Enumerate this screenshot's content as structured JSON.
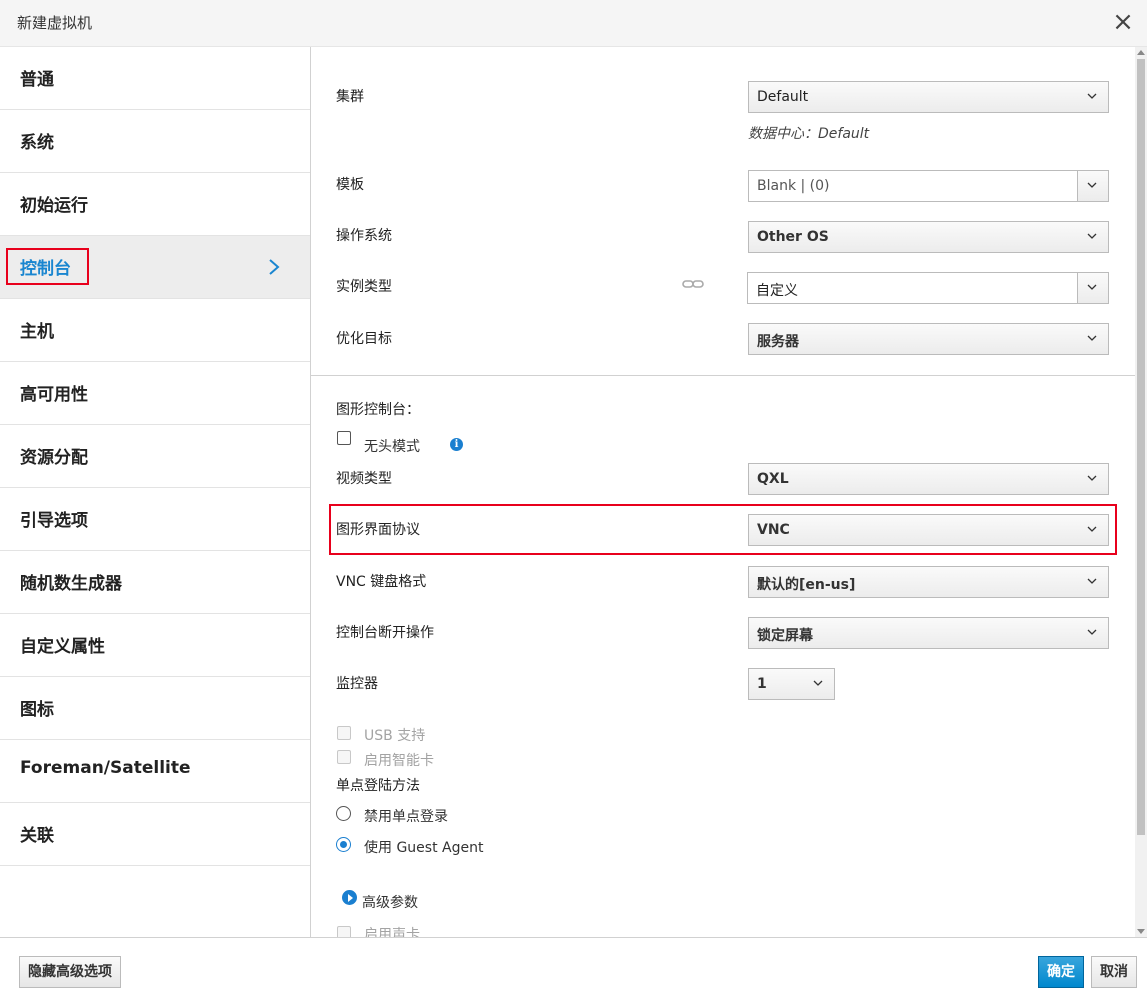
{
  "dialog": {
    "title": "新建虚拟机"
  },
  "sidebar": {
    "items": [
      {
        "label": "普通"
      },
      {
        "label": "系统"
      },
      {
        "label": "初始运行"
      },
      {
        "label": "控制台"
      },
      {
        "label": "主机"
      },
      {
        "label": "高可用性"
      },
      {
        "label": "资源分配"
      },
      {
        "label": "引导选项"
      },
      {
        "label": "随机数生成器"
      },
      {
        "label": "自定义属性"
      },
      {
        "label": "图标"
      },
      {
        "label": "Foreman/Satellite"
      },
      {
        "label": "关联"
      }
    ],
    "active_index": 3
  },
  "general": {
    "cluster": {
      "label": "集群",
      "value": "Default",
      "hint": "数据中心：Default"
    },
    "template": {
      "label": "模板",
      "value": "Blank |  (0)"
    },
    "os": {
      "label": "操作系统",
      "value": "Other OS"
    },
    "instance_type": {
      "label": "实例类型",
      "value": "自定义"
    },
    "optimized_for": {
      "label": "优化目标",
      "value": "服务器"
    }
  },
  "console": {
    "section_title": "图形控制台：",
    "headless": {
      "label": "无头模式",
      "checked": false
    },
    "video_type": {
      "label": "视频类型",
      "value": "QXL"
    },
    "graphics_protocol": {
      "label": "图形界面协议",
      "value": "VNC"
    },
    "vnc_keymap": {
      "label": "VNC 键盘格式",
      "value": "默认的[en-us]"
    },
    "disconnect_action": {
      "label": "控制台断开操作",
      "value": "锁定屏幕"
    },
    "monitors": {
      "label": "监控器",
      "value": "1"
    },
    "usb_support": {
      "label": "USB 支持",
      "checked": false,
      "disabled": true
    },
    "smartcard": {
      "label": "启用智能卡",
      "checked": false,
      "disabled": true
    },
    "sso_method": {
      "label": "单点登陆方法",
      "options": [
        {
          "label": "禁用单点登录",
          "selected": false
        },
        {
          "label": "使用 Guest Agent",
          "selected": true
        }
      ]
    },
    "advanced": {
      "label": "高级参数"
    },
    "soundcard": {
      "label": "启用声卡",
      "checked": false,
      "disabled": true
    }
  },
  "footer": {
    "hide_advanced": "隐藏高级选项",
    "ok": "确定",
    "cancel": "取消"
  },
  "colors": {
    "accent": "#0088ce",
    "highlight": "#e8001c"
  }
}
